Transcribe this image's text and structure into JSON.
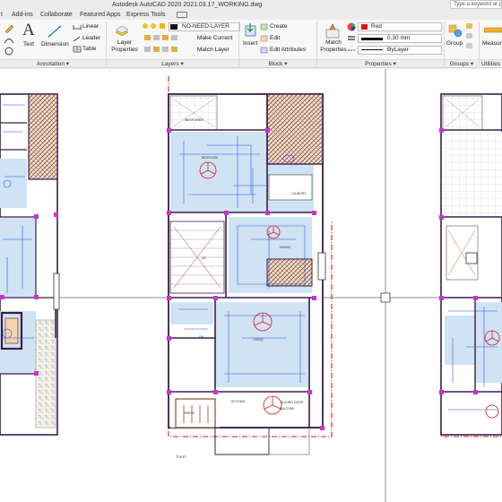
{
  "window": {
    "title": "Autodesk AutoCAD 2020    2021.03.17_WORKING.dwg",
    "search_placeholder": "Type a keyword or phrase"
  },
  "tabs": [
    "t",
    "Add-ins",
    "Collaborate",
    "Featured Apps",
    "Express Tools"
  ],
  "ribbon": {
    "annotation": {
      "text": "Text",
      "dimension": "Dimension",
      "linear": "Linear",
      "leader": "Leader",
      "table": "Table",
      "panel": "Annotation"
    },
    "layers": {
      "layer_properties": "Layer Properties",
      "current_layer": "NO-NEED-LAYER",
      "make_current": "Make Current",
      "match_layer": "Match Layer",
      "panel": "Layers"
    },
    "block": {
      "insert": "Insert",
      "create": "Create",
      "edit": "Edit",
      "edit_attributes": "Edit Attributes",
      "panel": "Block"
    },
    "properties": {
      "match_properties": "Match Properties",
      "color": "Red",
      "lineweight": "0.30 mm",
      "linetype": "ByLayer",
      "panel": "Properties"
    },
    "groups": {
      "group": "Group",
      "panel": "Groups"
    },
    "utilities": {
      "measure": "Measure",
      "panel": "Utilities"
    }
  },
  "colors": {
    "room_fill": "#cfe3f5",
    "wall": "#3b1e4d",
    "magenta": "#cc33cc",
    "red_boundary": "#d81b1b",
    "blue_lines": "#2f4fd8",
    "hatch_brown": "#8a4b2a"
  },
  "drawing": {
    "labels": [
      "WASH AREA",
      "BEDROOM",
      "LIVING",
      "KITCHEN",
      "DINING",
      "TOILET",
      "DRESS",
      "UP",
      "DN",
      "BALCONY",
      "SLIDING DOOR",
      "LAUNDRY"
    ]
  }
}
